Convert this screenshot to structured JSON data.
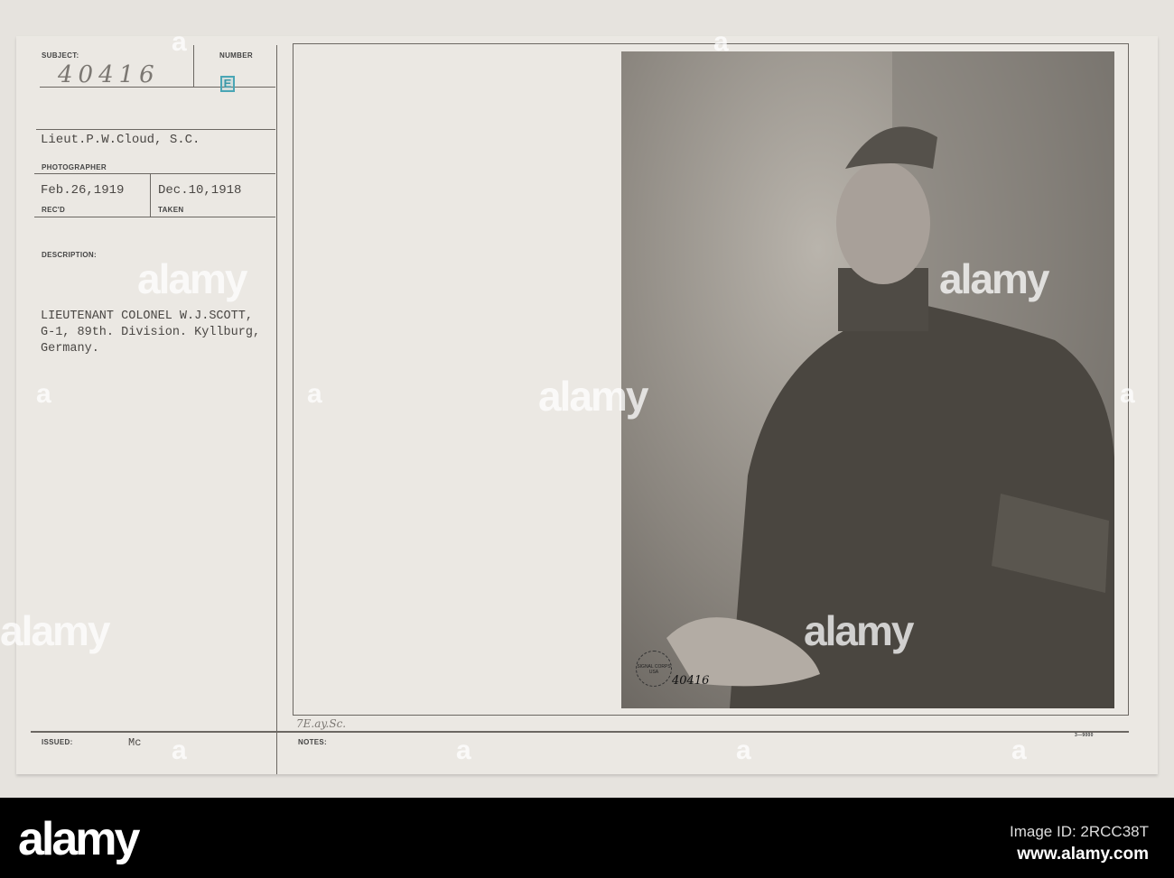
{
  "card": {
    "subject_label": "SUBJECT:",
    "subject_value": "40416",
    "number_label": "NUMBER",
    "number_stamp": "E",
    "photographer_value": "Lieut.P.W.Cloud, S.C.",
    "photographer_label": "PHOTOGRAPHER",
    "recd_value": "Feb.26,1919",
    "recd_label": "REC'D",
    "taken_value": "Dec.10,1918",
    "taken_label": "TAKEN",
    "description_label": "DESCRIPTION:",
    "description_lines": [
      "LIEUTENANT COLONEL W.J.SCOTT,",
      "G-1, 89th. Division. Kyllburg,",
      "Germany."
    ],
    "issued_label": "ISSUED:",
    "issued_value": "Mc",
    "notes_label": "NOTES:",
    "notes_value": "7E.ay.Sc.",
    "form_number": "3—9000",
    "photo_number": "40416",
    "photo_stamp": "SIGNAL CORPS USA"
  },
  "watermark": {
    "text": "alamy",
    "letter": "a"
  },
  "footer": {
    "logo": "alamy",
    "image_id": "Image ID: 2RCC38T",
    "site": "www.alamy.com"
  }
}
